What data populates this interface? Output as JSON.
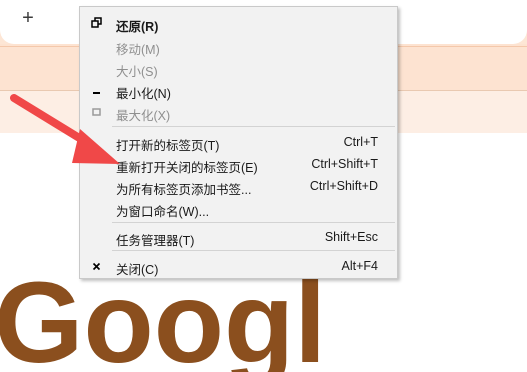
{
  "browser": {
    "new_tab_glyph": "+"
  },
  "context_menu": {
    "items": [
      {
        "label": "还原(R)",
        "shortcut": "",
        "icon": "restore-icon"
      },
      {
        "label": "移动(M)",
        "shortcut": "",
        "icon": ""
      },
      {
        "label": "大小(S)",
        "shortcut": "",
        "icon": ""
      },
      {
        "label": "最小化(N)",
        "shortcut": "",
        "icon": "minimize-icon"
      },
      {
        "label": "最大化(X)",
        "shortcut": "",
        "icon": "maximize-icon"
      },
      {
        "label": "打开新的标签页(T)",
        "shortcut": "Ctrl+T",
        "icon": ""
      },
      {
        "label": "重新打开关闭的标签页(E)",
        "shortcut": "Ctrl+Shift+T",
        "icon": ""
      },
      {
        "label": "为所有标签页添加书签...",
        "shortcut": "Ctrl+Shift+D",
        "icon": ""
      },
      {
        "label": "为窗口命名(W)...",
        "shortcut": "",
        "icon": ""
      },
      {
        "label": "任务管理器(T)",
        "shortcut": "Shift+Esc",
        "icon": ""
      },
      {
        "label": "关闭(C)",
        "shortcut": "Alt+F4",
        "icon": "close-icon"
      }
    ]
  },
  "page": {
    "logo_text": "Google"
  },
  "colors": {
    "tabstrip": "#fde6d5",
    "toolbar": "#fde3d1",
    "arrow": "#f04848",
    "logo": "#8b4f1e"
  }
}
